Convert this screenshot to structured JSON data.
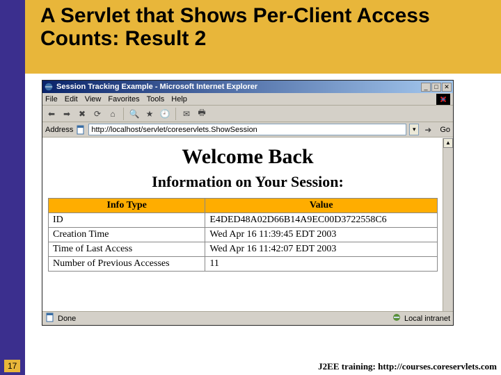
{
  "slide": {
    "title": "A Servlet that Shows Per-Client Access Counts: Result 2",
    "page_number": "17",
    "footer": "J2EE training: http://courses.coreservlets.com"
  },
  "browser": {
    "window_title": "Session Tracking Example - Microsoft Internet Explorer",
    "menu": {
      "file": "File",
      "edit": "Edit",
      "view": "View",
      "favorites": "Favorites",
      "tools": "Tools",
      "help": "Help"
    },
    "address_label": "Address",
    "url": "http://localhost/servlet/coreservlets.ShowSession",
    "go_label": "Go",
    "status_text": "Done",
    "zone_text": "Local intranet"
  },
  "page": {
    "heading": "Welcome Back",
    "subheading": "Information on Your Session:",
    "headers": {
      "col1": "Info Type",
      "col2": "Value"
    },
    "rows": [
      {
        "k": "ID",
        "v": "E4DED48A02D66B14A9EC00D3722558C6"
      },
      {
        "k": "Creation Time",
        "v": "Wed Apr 16 11:39:45 EDT 2003"
      },
      {
        "k": "Time of Last Access",
        "v": "Wed Apr 16 11:42:07 EDT 2003"
      },
      {
        "k": "Number of Previous Accesses",
        "v": "11"
      }
    ]
  }
}
